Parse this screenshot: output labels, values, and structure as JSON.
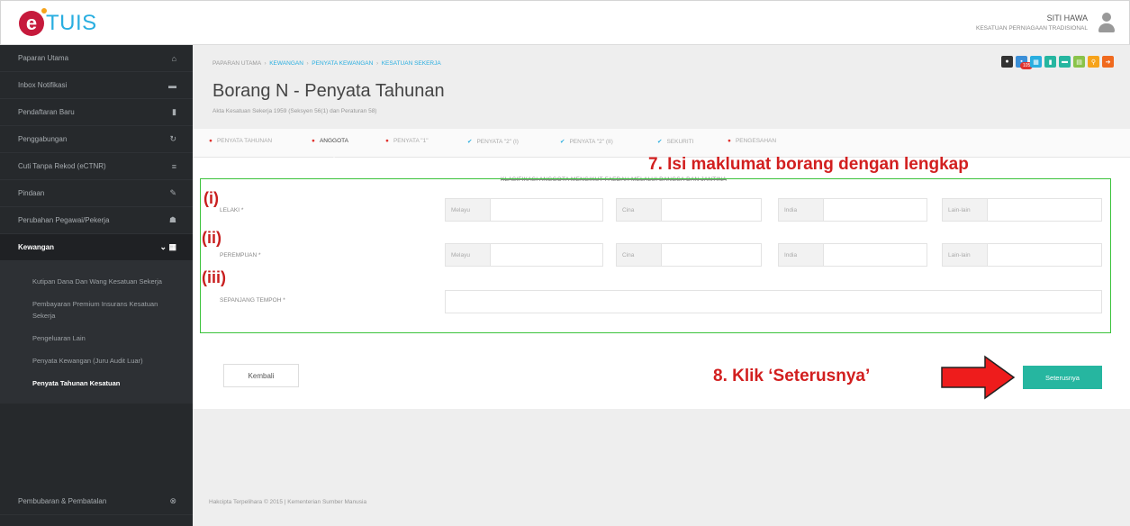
{
  "app": {
    "logo_text": "TUIS",
    "logo_letter": "e"
  },
  "user": {
    "name": "SITI HAWA",
    "org": "KESATUAN PERNIAGAAN TRADISIONAL"
  },
  "sidebar": {
    "items": [
      {
        "label": "Paparan Utama",
        "icon": "home-icon",
        "glyph": "⌂"
      },
      {
        "label": "Inbox Notifikasi",
        "icon": "inbox-icon",
        "glyph": "▬"
      },
      {
        "label": "Pendaftaran Baru",
        "icon": "file-icon",
        "glyph": "▮"
      },
      {
        "label": "Penggabungan",
        "icon": "refresh-icon",
        "glyph": "↻"
      },
      {
        "label": "Cuti Tanpa Rekod (eCTNR)",
        "icon": "list-icon",
        "glyph": "≡"
      },
      {
        "label": "Pindaan",
        "icon": "edit-icon",
        "glyph": "✎"
      },
      {
        "label": "Perubahan Pegawai/Pekerja",
        "icon": "users-icon",
        "glyph": "☗"
      },
      {
        "label": "Kewangan",
        "icon": "grid-icon",
        "glyph": "▦"
      }
    ],
    "subitems": [
      "Kutipan Dana Dan Wang Kesatuan Sekerja",
      "Pembayaran Premium Insurans Kesatuan Sekerja",
      "Pengeluaran Lain",
      "Penyata Kewangan (Juru Audit Luar)",
      "Penyata Tahunan Kesatuan"
    ],
    "bottom_item": {
      "label": "Pembubaran & Pembatalan",
      "glyph": "⊗"
    }
  },
  "header": {
    "breadcrumb": [
      "PAPARAN UTAMA",
      "KEWANGAN",
      "PENYATA KEWANGAN",
      "KESATUAN SEKERJA"
    ],
    "title": "Borang N - Penyata Tahunan",
    "subtitle": "Akta Kesatuan Sekerja 1959 (Seksyen 56(1) dan Peraturan 58)",
    "badge": "105",
    "action_colors": [
      "#333333",
      "#3b8fd8",
      "#29aee0",
      "#26b6a0",
      "#26b6a0",
      "#8ac34a",
      "#f6a31b",
      "#f06a1e"
    ]
  },
  "steps": [
    {
      "label": "PENYATA TAHUNAN",
      "mark": "●"
    },
    {
      "label": "ANGGOTA",
      "mark": "●"
    },
    {
      "label": "PENYATA \"1\"",
      "mark": "●"
    },
    {
      "label": "PENYATA \"2\" (I)",
      "mark": "✔"
    },
    {
      "label": "PENYATA \"2\" (II)",
      "mark": "✔"
    },
    {
      "label": "SEKURITI",
      "mark": "✔"
    },
    {
      "label": "PENGESAHAN",
      "mark": "●"
    }
  ],
  "form": {
    "title": "KLASIFIKASI ANGGOTA MENGIKUT FAEDAH MELALUI BANGSA DAN JANTINA",
    "row1": {
      "num": "(i)",
      "label": "LELAKI *"
    },
    "row2": {
      "num": "(ii)",
      "label": "PEREMPUAN *"
    },
    "row3": {
      "num": "(iii)",
      "label": "SEPANJANG TEMPOH *"
    },
    "placeholders": [
      "Melayu",
      "Cina",
      "India",
      "Lain-lain"
    ]
  },
  "annotations": {
    "step7": "7. Isi maklumat borang dengan lengkap",
    "step8": "8. Klik ‘Seterusnya’"
  },
  "buttons": {
    "back": "Kembali",
    "next": "Seterusnya"
  },
  "footer": "Hakcipta Terpelihara © 2015 | Kementerian Sumber Manusia"
}
